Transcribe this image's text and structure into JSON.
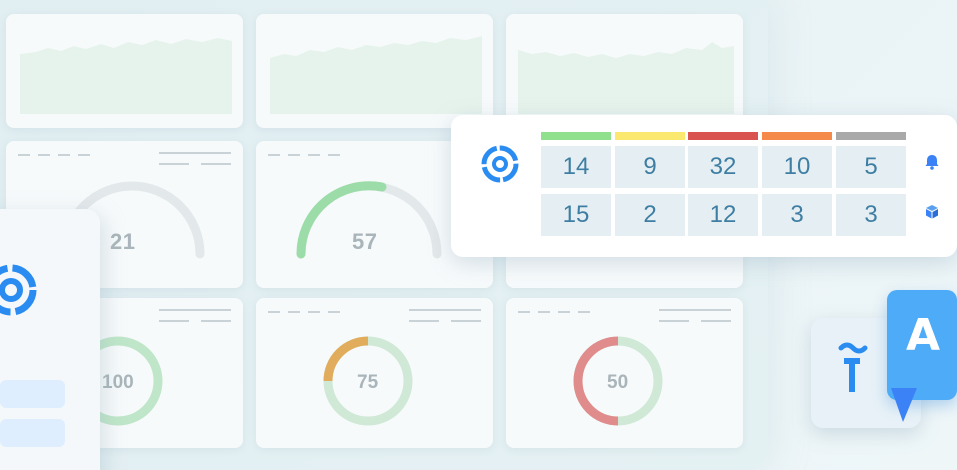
{
  "gauges": [
    {
      "value": "21",
      "fraction": 0.0
    },
    {
      "value": "57",
      "fraction": 0.57
    }
  ],
  "donuts": [
    {
      "value": "100"
    },
    {
      "value": "75"
    },
    {
      "value": "50"
    }
  ],
  "status_colors": [
    "#90e08e",
    "#fbe86e",
    "#d9534f",
    "#f4894a",
    "#a9a9a9"
  ],
  "status_table": {
    "rows": [
      {
        "icon": "bell-icon",
        "values": [
          "14",
          "9",
          "32",
          "10",
          "5"
        ]
      },
      {
        "icon": "cube-icon",
        "values": [
          "15",
          "2",
          "12",
          "3",
          "3"
        ]
      }
    ]
  },
  "colors": {
    "accent": "#2a8cf0",
    "cell_bg": "#e5eff3",
    "cell_text": "#3f7ea3",
    "gauge_green": "#9cdca8",
    "gauge_track": "#e3e8ea",
    "donut_orange": "#e1ad5c",
    "donut_red": "#e08c8c"
  },
  "translate_label": "A"
}
